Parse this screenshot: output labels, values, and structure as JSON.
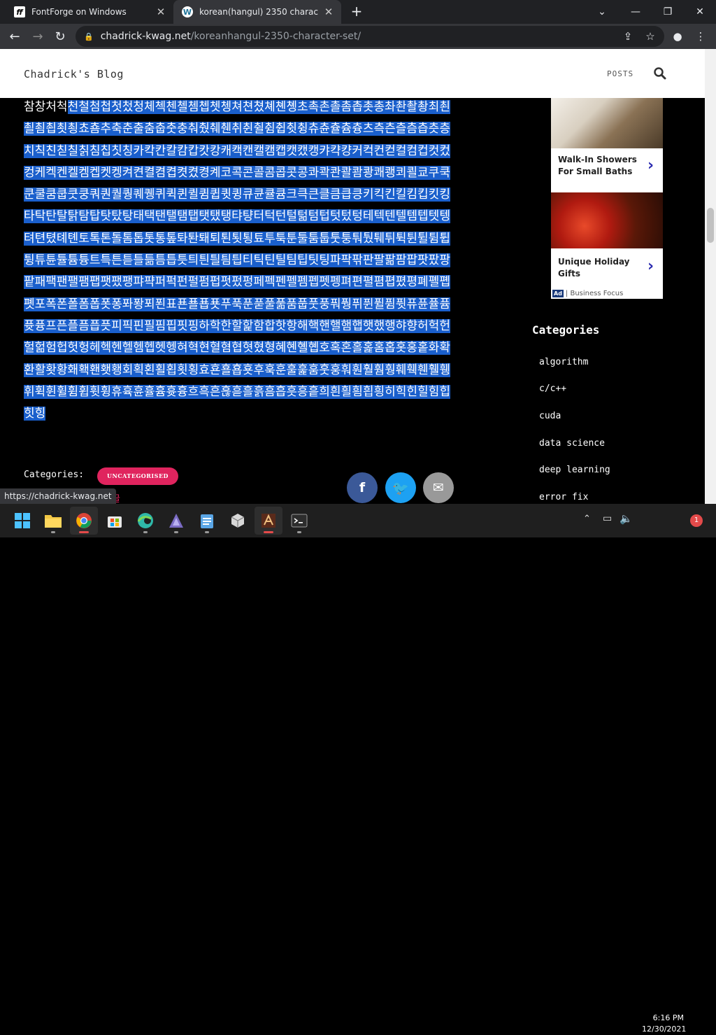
{
  "browser": {
    "tabs": [
      {
        "title": "FontForge on Windows",
        "favicon": "fontforge-icon"
      },
      {
        "title": "korean(hangul) 2350 character set",
        "favicon": "wordpress-icon"
      }
    ],
    "url_host": "chadrick-kwag.net",
    "url_path": "/koreanhangul-2350-character-set/",
    "status_url": "https://chadrick-kwag.net"
  },
  "site": {
    "title": "Chadrick's Blog",
    "nav": {
      "posts": "POSTS"
    }
  },
  "content": {
    "korean_unselected": "참창처척",
    "korean_selected": "천철첨첩첫첬청체첵첸첼쳄쳅쳇쳉쳐쳔쳤쳬쳰촁초촉촌촐촘촙촛총촤촨촬촹최쵠쵤쵬쵭쵯쵱쵸춈추축춘출춤춥춧충춰췄췌췐취췬췰췸췹췻췽츄츈츌츔츙츠측츤츨츰츱츳층치칙친칟칠칡침칩칫칭카칵칸칼캄캅캇캉캐캑캔캘캠캡캣캤캥캬캭컁커컥컨컫컬컴컵컷컸컹케켁켄켈켐켑켓켕켜켠켤켬켭켯켰켱켸코콕콘콜콤콥콧콩콰콱콴콸쾀쾅쾌쾡쾨쾰쿄쿠쿡쿤쿨쿰쿱쿳쿵쿼퀀퀄퀑퀘퀭퀴퀵퀸퀼큄큅큇큉큐큔큘큠크큭큰클큼큽킁키킥킨킬킴킵킷킹타탁탄탈탉탐탑탓탔탕태택탠탤탬탭탯탰탱탸턍터턱턴털턺텀텁텃텄텅테텍텐텔템텝텟텡텨텬텼톄톈토톡톤톨톰톱톳통톺톼퇀퇘퇴퇸툇툉툐투툭툰툴툼툽툿퉁퉈퉜퉤튀튁튄튈튐튑튕튜튠튤튬튱트특튼튿틀틂틈틉틋틔틘틜틤틥티틱틴틸팀팁팃팅파팍팎판팔팖팜팝팟팠팡팥패팩팬팰팸팹팻팼팽퍄퍅퍼퍽펀펄펌펍펏펐펑페펙펜펠펨펩펫펭펴편펼폄폅폈평폐폘폡폣포폭폰폴폼폽폿퐁퐈퐝푀푄표푠푤푭푯푸푹푼푿풀풂품풉풋풍풔풩퓌퓐퓔퓜퓟퓨퓬퓰퓸퓻퓽프픈플픔픕픗피픽핀필핌핍핏핑하학한할핥함합핫항해핵핸핼햄햅햇했행햐향허헉헌헐헒험헙헛헝헤헥헨헬헴헵헷헹혀혁현혈혐협혓혔형혜혠혤혭호혹혼홀홅홈홉홋홍홑화확환활홧황홰홱홴횃횅회획횐횔횝횟횡효횬횰횹횻후훅훈훌훑훔훗훙훠훤훨훰훵훼훽휀휄휑휘휙휜휠휨휩휫휭휴휵휸휼흄흇흉흐흑흔흖흗흘흙흠흡흣흥흩희흰흴흼흽힁히힉힌힐힘힙힛힝"
  },
  "post_meta": {
    "categories_label": "Categories:",
    "category_badge": "UNCATEGORISED",
    "tag": "한글"
  },
  "ad": {
    "item1": "Walk-In Showers For Small Baths",
    "item2": "Unique Holiday Gifts",
    "badge": "Ad",
    "sponsor": "| Business Focus"
  },
  "sidebar": {
    "heading": "Categories",
    "categories": [
      "algorithm",
      "c/c++",
      "cuda",
      "data science",
      "deep learning",
      "error fix"
    ]
  },
  "taskbar": {
    "time": "6:16 PM",
    "date": "12/30/2021",
    "notifications": "1"
  },
  "colors": {
    "selection": "#1a5fcc",
    "badge": "#e0245e",
    "facebook": "#3b5998",
    "twitter": "#1da1f2",
    "email": "#999999"
  }
}
